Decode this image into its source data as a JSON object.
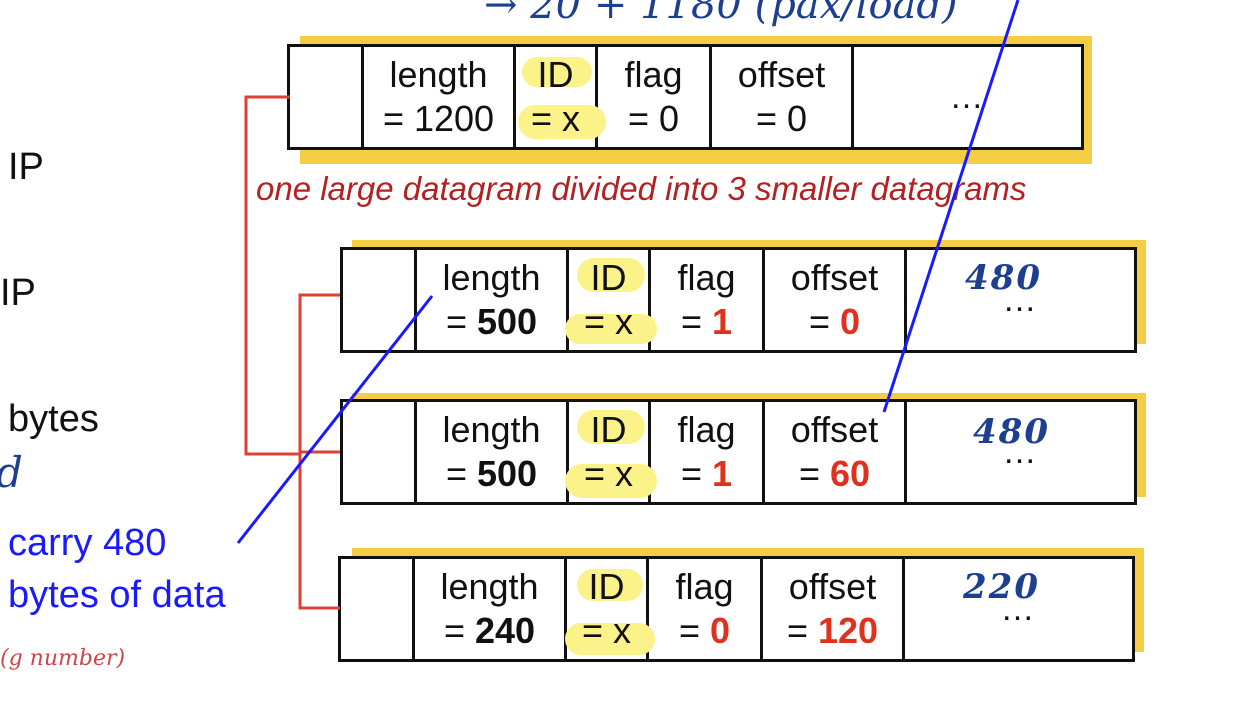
{
  "left": {
    "ip1": "IP",
    "ip2": "IP",
    "bytes": "bytes",
    "partial": "d"
  },
  "blue_note": {
    "line1": "carry 480",
    "line2": "bytes of data"
  },
  "caption": "one large datagram divided into 3 smaller datagrams",
  "handwriting": {
    "top": "→ 20 + 1180 (pax/load)",
    "h1": "480",
    "h2": "480",
    "h3": "220",
    "bottom_left": "(g number)"
  },
  "original": {
    "length_label": "length",
    "length_value": "= 1200",
    "id_label": "ID",
    "id_value": "= x",
    "flag_label": "flag",
    "flag_value": "= 0",
    "offset_label": "offset",
    "offset_value": "= 0",
    "data": "…"
  },
  "fragments": [
    {
      "length_label": "length",
      "length_eq": "= ",
      "length_num": "500",
      "id_label": "ID",
      "id_value": "= x",
      "flag_label": "flag",
      "flag_eq": "= ",
      "flag_num": "1",
      "offset_label": "offset",
      "offset_eq": "= ",
      "offset_num": "0",
      "data": "…"
    },
    {
      "length_label": "length",
      "length_eq": "= ",
      "length_num": "500",
      "id_label": "ID",
      "id_value": "= x",
      "flag_label": "flag",
      "flag_eq": "= ",
      "flag_num": "1",
      "offset_label": "offset",
      "offset_eq": "= ",
      "offset_num": "60",
      "data": "…"
    },
    {
      "length_label": "length",
      "length_eq": "= ",
      "length_num": "240",
      "id_label": "ID",
      "id_value": "= x",
      "flag_label": "flag",
      "flag_eq": "= ",
      "flag_num": "0",
      "offset_label": "offset",
      "offset_eq": "= ",
      "offset_num": "120",
      "data": "…"
    }
  ],
  "colors": {
    "shadow": "#f4cc45",
    "highlight": "#fbf28a",
    "caption": "#b22222",
    "accent_red": "#e0301e",
    "ink_blue": "#1a1aff",
    "bracket": "#e04030"
  }
}
